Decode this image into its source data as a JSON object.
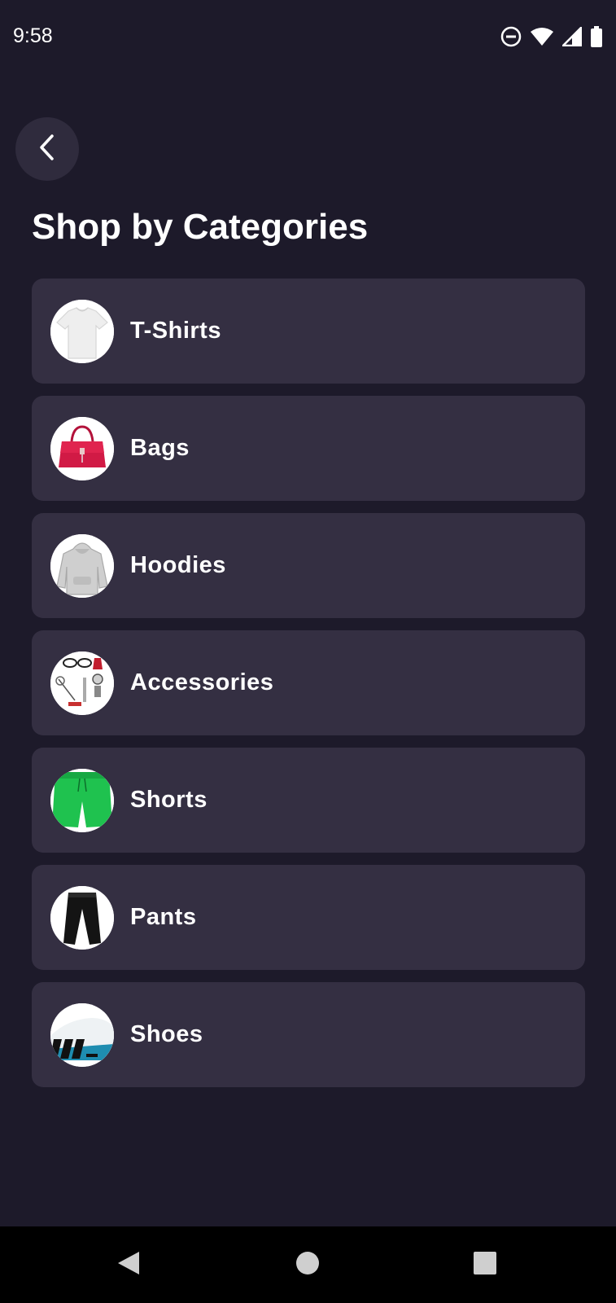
{
  "status_bar": {
    "time": "9:58",
    "icons": [
      "do-not-disturb-icon",
      "wifi-icon",
      "signal-icon",
      "battery-icon"
    ]
  },
  "header": {
    "back_icon": "chevron-left-icon",
    "title": "Shop by Categories"
  },
  "categories": [
    {
      "label": "T-Shirts",
      "image": "white-tshirt"
    },
    {
      "label": "Bags",
      "image": "red-handbag"
    },
    {
      "label": "Hoodies",
      "image": "grey-hoodie"
    },
    {
      "label": "Accessories",
      "image": "assorted-accessories"
    },
    {
      "label": "Shorts",
      "image": "green-shorts"
    },
    {
      "label": "Pants",
      "image": "black-pants"
    },
    {
      "label": "Shoes",
      "image": "white-sneaker"
    }
  ],
  "nav_bar": {
    "back": "triangle-back-icon",
    "home": "circle-home-icon",
    "recents": "square-recents-icon"
  },
  "colors": {
    "background": "#1d1a2a",
    "card": "#342f42",
    "back_button": "#2f2b3d",
    "text": "#ffffff"
  }
}
